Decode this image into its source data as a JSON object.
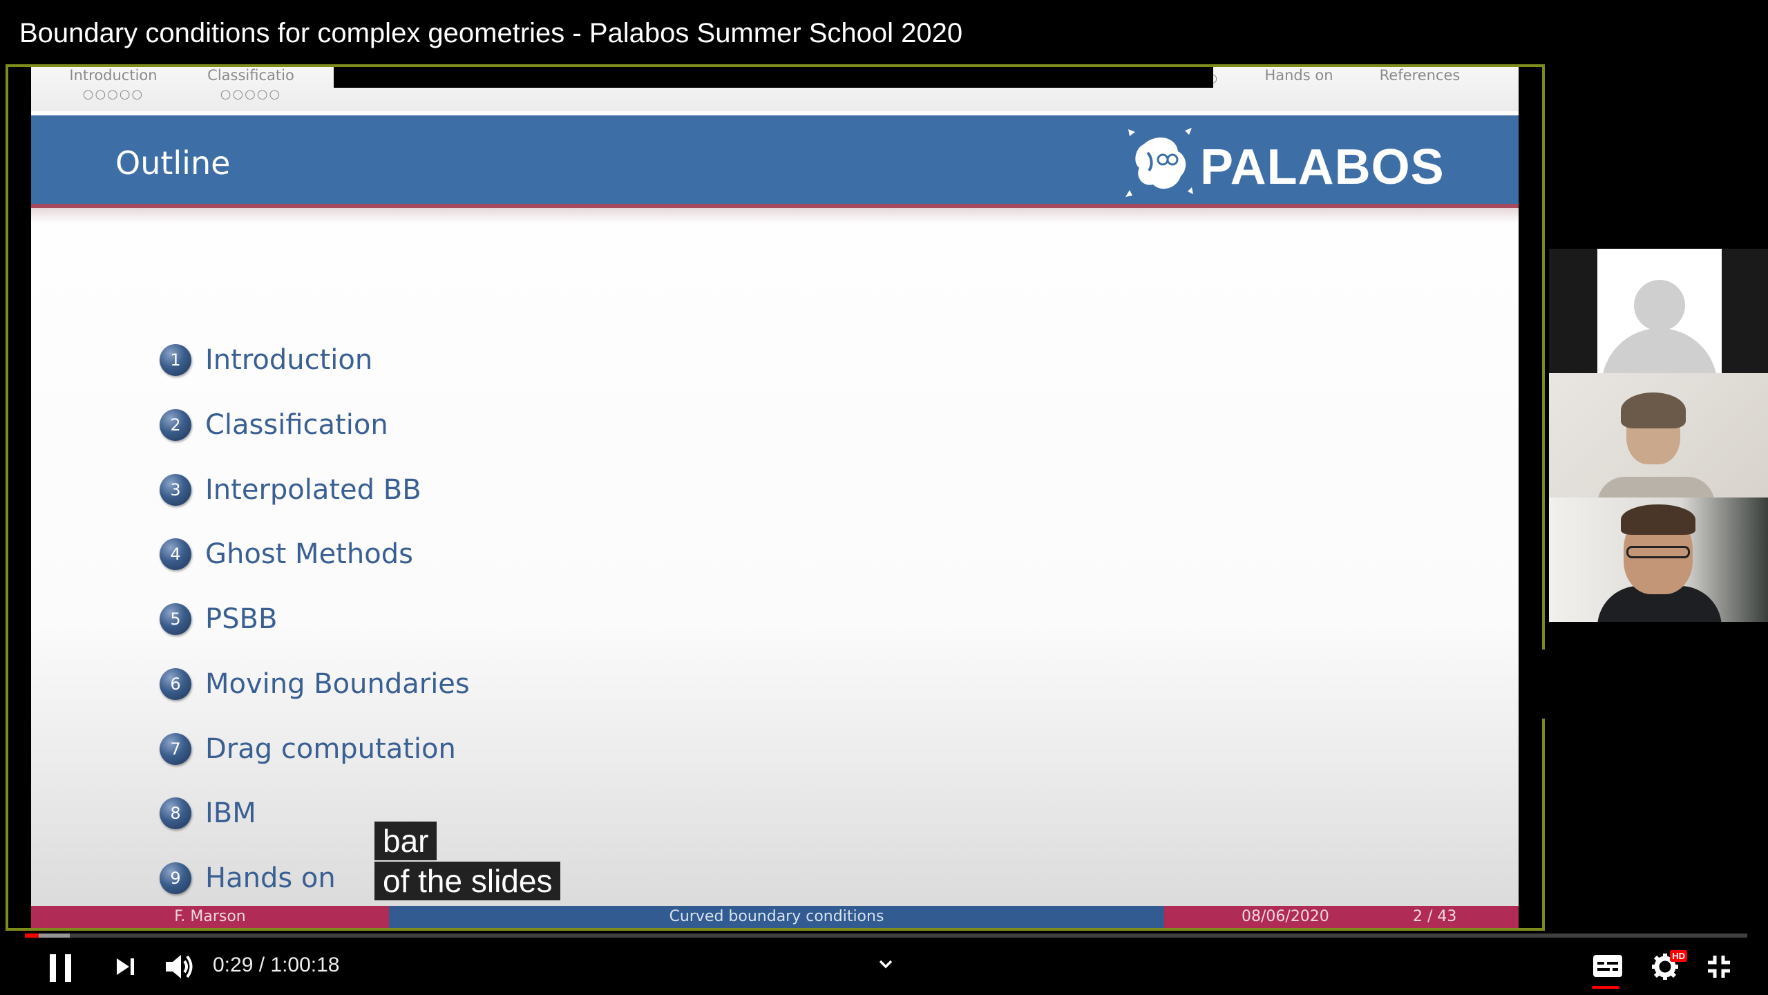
{
  "video": {
    "title": "Boundary conditions for complex geometries - Palabos Summer School 2020"
  },
  "slide": {
    "nav": [
      {
        "label": "Introduction",
        "dots": "○○○○○"
      },
      {
        "label": "Classificatio",
        "dots": "○○○○○"
      },
      {
        "label": "",
        "dots": "○○○○○○○"
      },
      {
        "label": "",
        "dots": "○○○○○○○"
      },
      {
        "label": "",
        "dots": "○○"
      },
      {
        "label": "",
        "dots": "○○"
      },
      {
        "label": "",
        "dots": "○○○"
      },
      {
        "label": "",
        "dots": "○○○○○"
      },
      {
        "label": "Hands on",
        "dots": ""
      },
      {
        "label": "References",
        "dots": ""
      }
    ],
    "heading": "Outline",
    "logo_text": "PALABOS",
    "outline": [
      {
        "num": "1",
        "label": "Introduction"
      },
      {
        "num": "2",
        "label": "Classification"
      },
      {
        "num": "3",
        "label": "Interpolated BB"
      },
      {
        "num": "4",
        "label": "Ghost Methods"
      },
      {
        "num": "5",
        "label": "PSBB"
      },
      {
        "num": "6",
        "label": "Moving Boundaries"
      },
      {
        "num": "7",
        "label": "Drag computation"
      },
      {
        "num": "8",
        "label": "IBM"
      },
      {
        "num": "9",
        "label": "Hands on"
      }
    ],
    "footer": {
      "author": "F. Marson",
      "title": "Curved boundary conditions",
      "date": "08/06/2020",
      "page": "2 / 43"
    }
  },
  "captions": {
    "line1": "bar",
    "line2": "of the slides"
  },
  "player": {
    "time": "0:29 / 1:00:18",
    "progress_fraction": 0.008,
    "buffer_fraction": 0.026,
    "hd_badge": "HD",
    "icons": {
      "play_pause": "pause-icon",
      "next": "next-icon",
      "volume": "volume-icon",
      "chapters": "chevron-down-icon",
      "captions": "subtitles-icon",
      "settings": "gear-icon",
      "fullscreen": "exit-fullscreen-icon"
    }
  },
  "colors": {
    "slide_banner": "#3d6ea6",
    "slide_text": "#3a5f93",
    "footer_accent": "#b02b55",
    "zoom_frame": "#7f8c1c",
    "progress": "#ff0000"
  }
}
